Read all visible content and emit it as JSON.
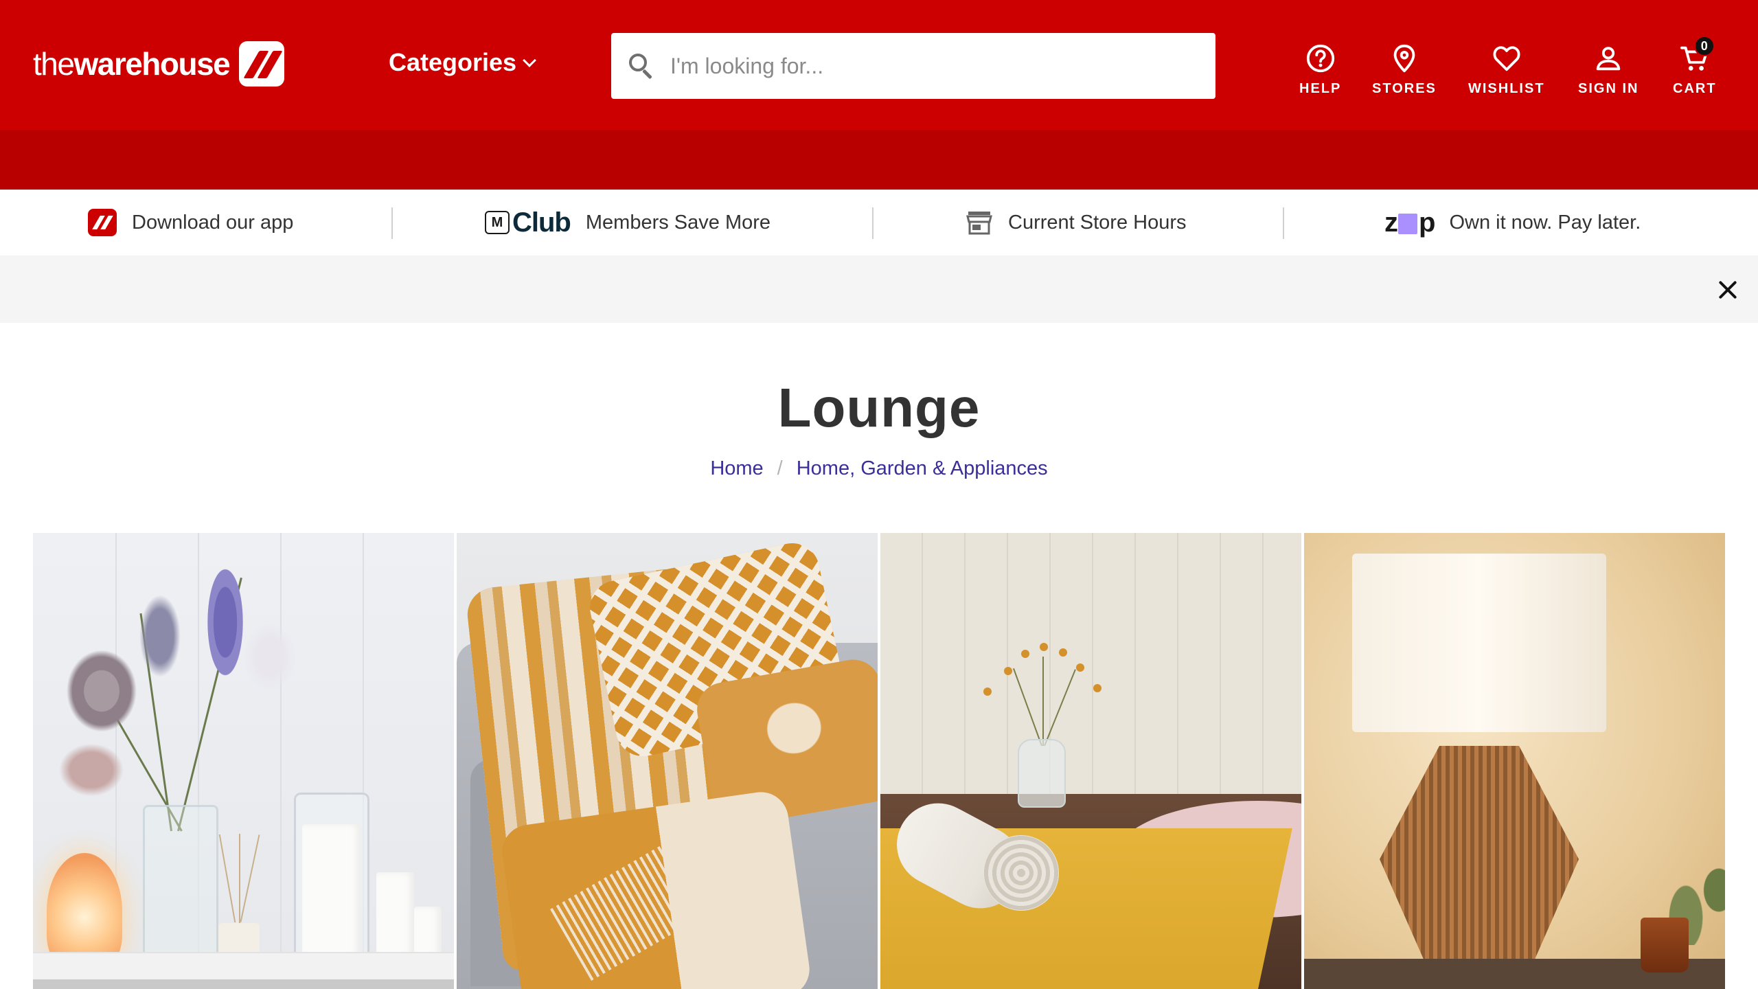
{
  "header": {
    "logo": {
      "thin": "the",
      "bold": "warehouse"
    },
    "categories_label": "Categories",
    "search": {
      "placeholder": "I'm looking for...",
      "value": ""
    },
    "nav": [
      {
        "id": "help",
        "label": "HELP",
        "icon": "help-icon"
      },
      {
        "id": "stores",
        "label": "STORES",
        "icon": "location-pin-icon"
      },
      {
        "id": "wishlist",
        "label": "WISHLIST",
        "icon": "heart-icon"
      },
      {
        "id": "signin",
        "label": "SIGN IN",
        "icon": "user-icon"
      },
      {
        "id": "cart",
        "label": "CART",
        "icon": "cart-icon"
      }
    ],
    "cart_count": "0",
    "colors": {
      "brand_red": "#cc0000",
      "band_red": "#b80000"
    }
  },
  "promo": {
    "app": "Download our app",
    "mclub_logo": {
      "m": "M",
      "club": "Club"
    },
    "mclub": "Members Save More",
    "store_hours": "Current Store Hours",
    "zip_logo": {
      "z": "z",
      "p": "p"
    },
    "zip": "Own it now. Pay later."
  },
  "page": {
    "title": "Lounge",
    "breadcrumb": [
      "Home",
      "Home, Garden & Appliances"
    ],
    "breadcrumb_sep": "/",
    "link_color": "#3a2e9a"
  },
  "tiles": [
    {
      "icon": "flowers-candles-image"
    },
    {
      "icon": "throw-cushions-image"
    },
    {
      "icon": "rugs-image"
    },
    {
      "icon": "table-lamp-image"
    }
  ]
}
